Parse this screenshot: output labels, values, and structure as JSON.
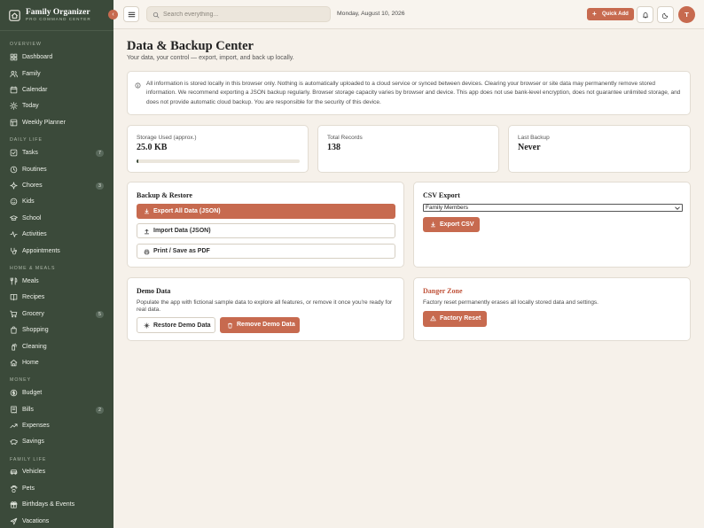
{
  "brand": {
    "title": "Family Organizer",
    "subtitle": "PRO COMMAND CENTER"
  },
  "sidebar": {
    "sections": [
      {
        "label": "OVERVIEW"
      },
      {
        "label": "DAILY LIFE"
      },
      {
        "label": "HOME & MEALS"
      },
      {
        "label": "MONEY"
      },
      {
        "label": "FAMILY LIFE"
      }
    ],
    "items": [
      {
        "label": "Dashboard",
        "icon": "grid-icon"
      },
      {
        "label": "Family",
        "icon": "users-icon"
      },
      {
        "label": "Calendar",
        "icon": "calendar-icon"
      },
      {
        "label": "Today",
        "icon": "sun-icon"
      },
      {
        "label": "Weekly Planner",
        "icon": "planner-icon"
      },
      {
        "label": "Tasks",
        "icon": "check-square-icon",
        "badge": "7"
      },
      {
        "label": "Routines",
        "icon": "clock-icon"
      },
      {
        "label": "Chores",
        "icon": "sparkle-icon",
        "badge": "3"
      },
      {
        "label": "Kids",
        "icon": "smile-icon"
      },
      {
        "label": "School",
        "icon": "graduation-cap-icon"
      },
      {
        "label": "Activities",
        "icon": "activity-icon"
      },
      {
        "label": "Appointments",
        "icon": "stethoscope-icon"
      },
      {
        "label": "Meals",
        "icon": "utensils-icon"
      },
      {
        "label": "Recipes",
        "icon": "book-icon"
      },
      {
        "label": "Grocery",
        "icon": "cart-icon",
        "badge": "5"
      },
      {
        "label": "Shopping",
        "icon": "bag-icon"
      },
      {
        "label": "Cleaning",
        "icon": "spray-icon"
      },
      {
        "label": "Home",
        "icon": "house-icon"
      },
      {
        "label": "Budget",
        "icon": "dollar-icon"
      },
      {
        "label": "Bills",
        "icon": "receipt-icon",
        "badge": "2"
      },
      {
        "label": "Expenses",
        "icon": "trending-icon"
      },
      {
        "label": "Savings",
        "icon": "piggy-bank-icon"
      },
      {
        "label": "Vehicles",
        "icon": "car-icon"
      },
      {
        "label": "Pets",
        "icon": "paw-icon"
      },
      {
        "label": "Birthdays & Events",
        "icon": "gift-icon"
      },
      {
        "label": "Vacations",
        "icon": "plane-icon"
      }
    ]
  },
  "topbar": {
    "search_placeholder": "Search everything...",
    "date": "Monday, August 10, 2026",
    "quick_add": "Quick Add",
    "avatar_initial": "T"
  },
  "page": {
    "title": "Data & Backup Center",
    "subtitle": "Your data, your control — export, import, and back up locally."
  },
  "info": {
    "text": "All information is stored locally in this browser only. Nothing is automatically uploaded to a cloud service or synced between devices. Clearing your browser or site data may permanently remove stored information. We recommend exporting a JSON backup regularly. Browser storage capacity varies by browser and device. This app does not use bank-level encryption, does not guarantee unlimited storage, and does not provide automatic cloud backup. You are responsible for the security of this device."
  },
  "stats": {
    "storage": {
      "label": "Storage Used (approx.)",
      "value": "25.0 KB",
      "fill_fraction": 0.01
    },
    "records": {
      "label": "Total Records",
      "value": "138"
    },
    "backup": {
      "label": "Last Backup",
      "value": "Never"
    }
  },
  "backup_restore": {
    "title": "Backup & Restore",
    "export_json": "Export All Data (JSON)",
    "import_json": "Import Data (JSON)",
    "print_pdf": "Print / Save as PDF"
  },
  "csv_export": {
    "title": "CSV Export",
    "selected": "Family Members",
    "button": "Export CSV"
  },
  "demo": {
    "title": "Demo Data",
    "description": "Populate the app with fictional sample data to explore all features, or remove it once you're ready for real data.",
    "restore": "Restore Demo Data",
    "remove": "Remove Demo Data"
  },
  "danger": {
    "title": "Danger Zone",
    "description": "Factory reset permanently erases all locally stored data and settings.",
    "button": "Factory Reset"
  },
  "colors": {
    "sidebar_bg": "#3b4a3a",
    "accent": "#c76a4f",
    "page_bg": "#f6f1ea",
    "danger": "#c0533a"
  }
}
